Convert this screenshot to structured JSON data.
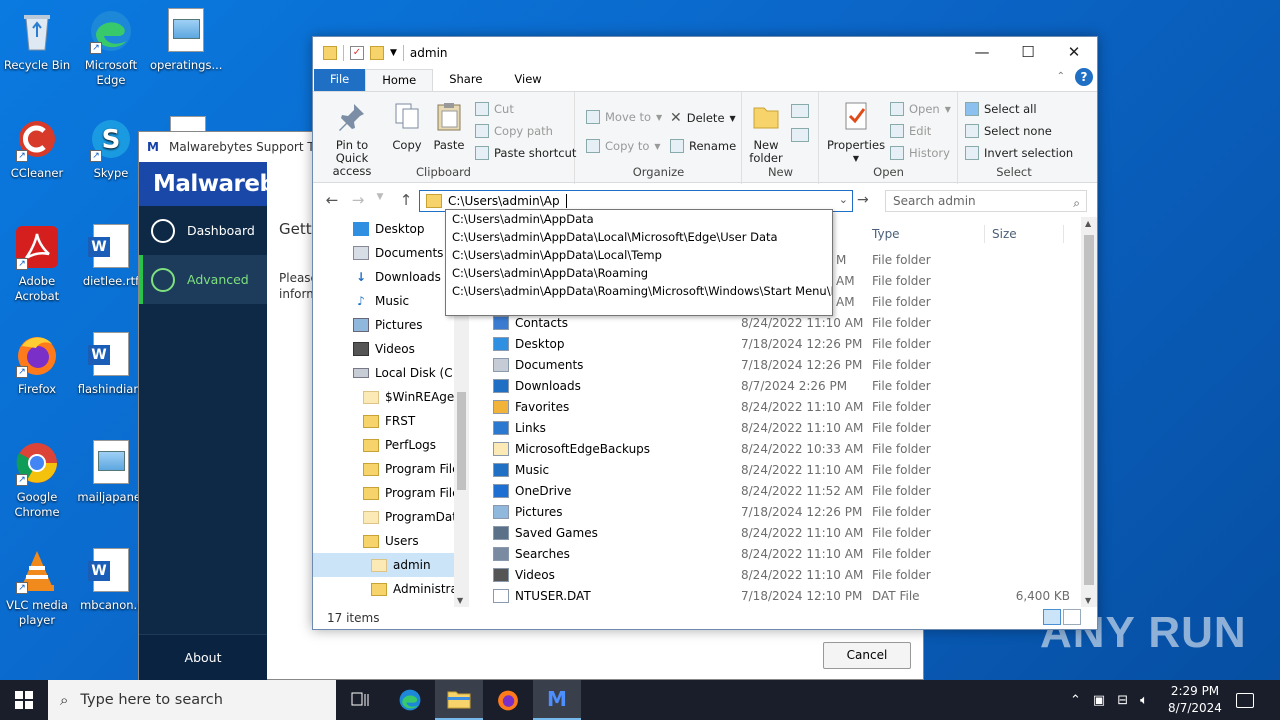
{
  "desktop": {
    "icons": [
      {
        "label": "Recycle Bin"
      },
      {
        "label": "Microsoft Edge"
      },
      {
        "label": "operatings..."
      },
      {
        "label": "CCleaner"
      },
      {
        "label": "Skype"
      },
      {
        "label": "Adobe Acrobat"
      },
      {
        "label": "dietlee.rtf"
      },
      {
        "label": "Firefox"
      },
      {
        "label": "flashindian."
      },
      {
        "label": "Google Chrome"
      },
      {
        "label": "mailjapane."
      },
      {
        "label": "VLC media player"
      },
      {
        "label": "mbcanon.r"
      }
    ],
    "watermark": "ANY RUN"
  },
  "malwarebytes": {
    "window_title": "Malwarebytes Support Tool",
    "brand": "Malwarebytes",
    "nav": {
      "dashboard": "Dashboard",
      "advanced": "Advanced",
      "about": "About"
    },
    "heading_partial": "Getti",
    "body_partial_1": "Please",
    "body_partial_2": "inform",
    "cancel_label": "Cancel"
  },
  "explorer": {
    "title": "admin",
    "controls": {
      "minimize": "—",
      "maximize": "☐",
      "close": "✕"
    },
    "tabs": {
      "file": "File",
      "home": "Home",
      "share": "Share",
      "view": "View"
    },
    "ribbon": {
      "clipboard": {
        "label": "Clipboard",
        "pin": "Pin to Quick access",
        "copy": "Copy",
        "paste": "Paste",
        "cut": "Cut",
        "copy_path": "Copy path",
        "paste_shortcut": "Paste shortcut"
      },
      "organize": {
        "label": "Organize",
        "move_to": "Move to",
        "copy_to": "Copy to",
        "delete": "Delete",
        "rename": "Rename"
      },
      "new": {
        "label": "New",
        "new_folder": "New folder"
      },
      "open": {
        "label": "Open",
        "properties": "Properties",
        "open": "Open",
        "edit": "Edit",
        "history": "History"
      },
      "select": {
        "label": "Select",
        "select_all": "Select all",
        "select_none": "Select none",
        "invert": "Invert selection"
      }
    },
    "address_value": "C:\\Users\\admin\\Ap",
    "search_placeholder": "Search admin",
    "autocomplete": [
      "C:\\Users\\admin\\AppData",
      "C:\\Users\\admin\\AppData\\Local\\Microsoft\\Edge\\User Data",
      "C:\\Users\\admin\\AppData\\Local\\Temp",
      "C:\\Users\\admin\\AppData\\Roaming",
      "C:\\Users\\admin\\AppData\\Roaming\\Microsoft\\Windows\\Start Menu\\Pro"
    ],
    "tree": [
      {
        "label": "Desktop"
      },
      {
        "label": "Documents"
      },
      {
        "label": "Downloads"
      },
      {
        "label": "Music"
      },
      {
        "label": "Pictures"
      },
      {
        "label": "Videos"
      },
      {
        "label": "Local Disk (C:)"
      },
      {
        "label": "$WinREAgent"
      },
      {
        "label": "FRST"
      },
      {
        "label": "PerfLogs"
      },
      {
        "label": "Program Files"
      },
      {
        "label": "Program Files"
      },
      {
        "label": "ProgramData"
      },
      {
        "label": "Users"
      },
      {
        "label": "admin"
      },
      {
        "label": "Administrat"
      }
    ],
    "columns": {
      "type": "Type",
      "size": "Size"
    },
    "rows_hidden_dates": [
      "M",
      "AM",
      "AM"
    ],
    "hidden_types": [
      "File folder",
      "File folder",
      "File folder"
    ],
    "rows": [
      {
        "name": "Contacts",
        "date": "8/24/2022 11:10 AM",
        "type": "File folder",
        "size": ""
      },
      {
        "name": "Desktop",
        "date": "7/18/2024 12:26 PM",
        "type": "File folder",
        "size": ""
      },
      {
        "name": "Documents",
        "date": "7/18/2024 12:26 PM",
        "type": "File folder",
        "size": ""
      },
      {
        "name": "Downloads",
        "date": "8/7/2024 2:26 PM",
        "type": "File folder",
        "size": ""
      },
      {
        "name": "Favorites",
        "date": "8/24/2022 11:10 AM",
        "type": "File folder",
        "size": ""
      },
      {
        "name": "Links",
        "date": "8/24/2022 11:10 AM",
        "type": "File folder",
        "size": ""
      },
      {
        "name": "MicrosoftEdgeBackups",
        "date": "8/24/2022 10:33 AM",
        "type": "File folder",
        "size": ""
      },
      {
        "name": "Music",
        "date": "8/24/2022 11:10 AM",
        "type": "File folder",
        "size": ""
      },
      {
        "name": "OneDrive",
        "date": "8/24/2022 11:52 AM",
        "type": "File folder",
        "size": ""
      },
      {
        "name": "Pictures",
        "date": "7/18/2024 12:26 PM",
        "type": "File folder",
        "size": ""
      },
      {
        "name": "Saved Games",
        "date": "8/24/2022 11:10 AM",
        "type": "File folder",
        "size": ""
      },
      {
        "name": "Searches",
        "date": "8/24/2022 11:10 AM",
        "type": "File folder",
        "size": ""
      },
      {
        "name": "Videos",
        "date": "8/24/2022 11:10 AM",
        "type": "File folder",
        "size": ""
      },
      {
        "name": "NTUSER.DAT",
        "date": "7/18/2024 12:10 PM",
        "type": "DAT File",
        "size": "6,400 KB"
      }
    ],
    "status": "17 items"
  },
  "taskbar": {
    "search_placeholder": "Type here to search",
    "time": "2:29 PM",
    "date": "8/7/2024"
  }
}
